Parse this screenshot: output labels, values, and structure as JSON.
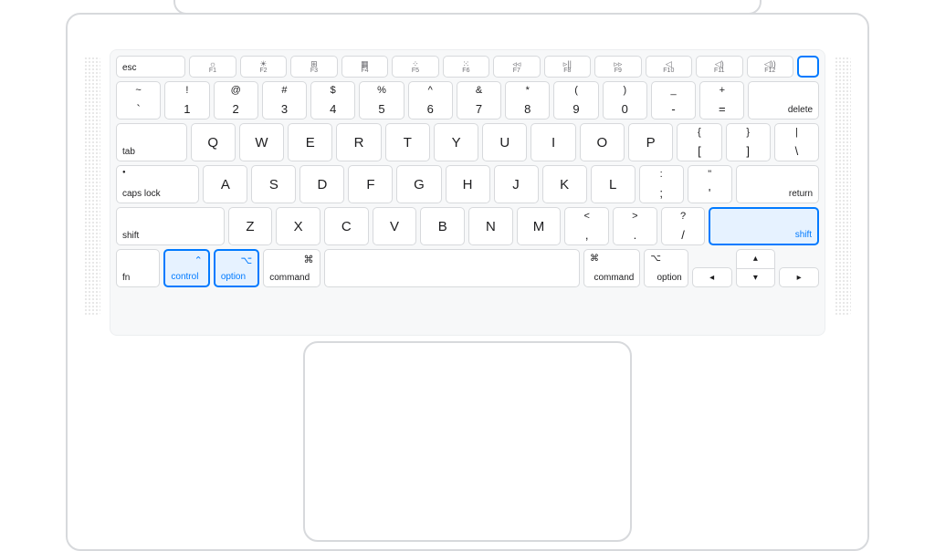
{
  "diagram": {
    "device": "MacBook keyboard layout",
    "highlighted_keys": [
      "touch-id",
      "shift-right",
      "control-left",
      "option-left"
    ]
  },
  "fn_row": {
    "esc": "esc",
    "keys": [
      {
        "label": "F1",
        "glyph": "☼"
      },
      {
        "label": "F2",
        "glyph": "☀"
      },
      {
        "label": "F3",
        "glyph": "⊞"
      },
      {
        "label": "F4",
        "glyph": "▦"
      },
      {
        "label": "F5",
        "glyph": "⁘"
      },
      {
        "label": "F6",
        "glyph": "⁙"
      },
      {
        "label": "F7",
        "glyph": "◃◃"
      },
      {
        "label": "F8",
        "glyph": "▹||"
      },
      {
        "label": "F9",
        "glyph": "▹▹"
      },
      {
        "label": "F10",
        "glyph": "◁"
      },
      {
        "label": "F11",
        "glyph": "◁)"
      },
      {
        "label": "F12",
        "glyph": "◁))"
      }
    ]
  },
  "num_row": [
    {
      "t": "~",
      "b": "`"
    },
    {
      "t": "!",
      "b": "1"
    },
    {
      "t": "@",
      "b": "2"
    },
    {
      "t": "#",
      "b": "3"
    },
    {
      "t": "$",
      "b": "4"
    },
    {
      "t": "%",
      "b": "5"
    },
    {
      "t": "^",
      "b": "6"
    },
    {
      "t": "&",
      "b": "7"
    },
    {
      "t": "*",
      "b": "8"
    },
    {
      "t": "(",
      "b": "9"
    },
    {
      "t": ")",
      "b": "0"
    },
    {
      "t": "_",
      "b": "-"
    },
    {
      "t": "+",
      "b": "="
    }
  ],
  "delete": "delete",
  "tab": "tab",
  "q_row": [
    "Q",
    "W",
    "E",
    "R",
    "T",
    "Y",
    "U",
    "I",
    "O",
    "P"
  ],
  "q_row_end": [
    {
      "t": "{",
      "b": "["
    },
    {
      "t": "}",
      "b": "]"
    },
    {
      "t": "|",
      "b": "\\"
    }
  ],
  "caps": "caps lock",
  "caps_dot": "●",
  "a_row": [
    "A",
    "S",
    "D",
    "F",
    "G",
    "H",
    "J",
    "K",
    "L"
  ],
  "a_row_end": [
    {
      "t": ":",
      "b": ";"
    },
    {
      "t": "\"",
      "b": "'"
    }
  ],
  "return": "return",
  "shift": "shift",
  "z_row": [
    "Z",
    "X",
    "C",
    "V",
    "B",
    "N",
    "M"
  ],
  "z_row_end": [
    {
      "t": "<",
      "b": ","
    },
    {
      "t": ">",
      "b": "."
    },
    {
      "t": "?",
      "b": "/"
    }
  ],
  "mods": {
    "fn": "fn",
    "control": "control",
    "control_sym": "⌃",
    "option": "option",
    "option_sym": "⌥",
    "command": "command",
    "command_sym": "⌘"
  },
  "arrows": {
    "left": "◂",
    "up": "▴",
    "down": "▾",
    "right": "▸"
  }
}
